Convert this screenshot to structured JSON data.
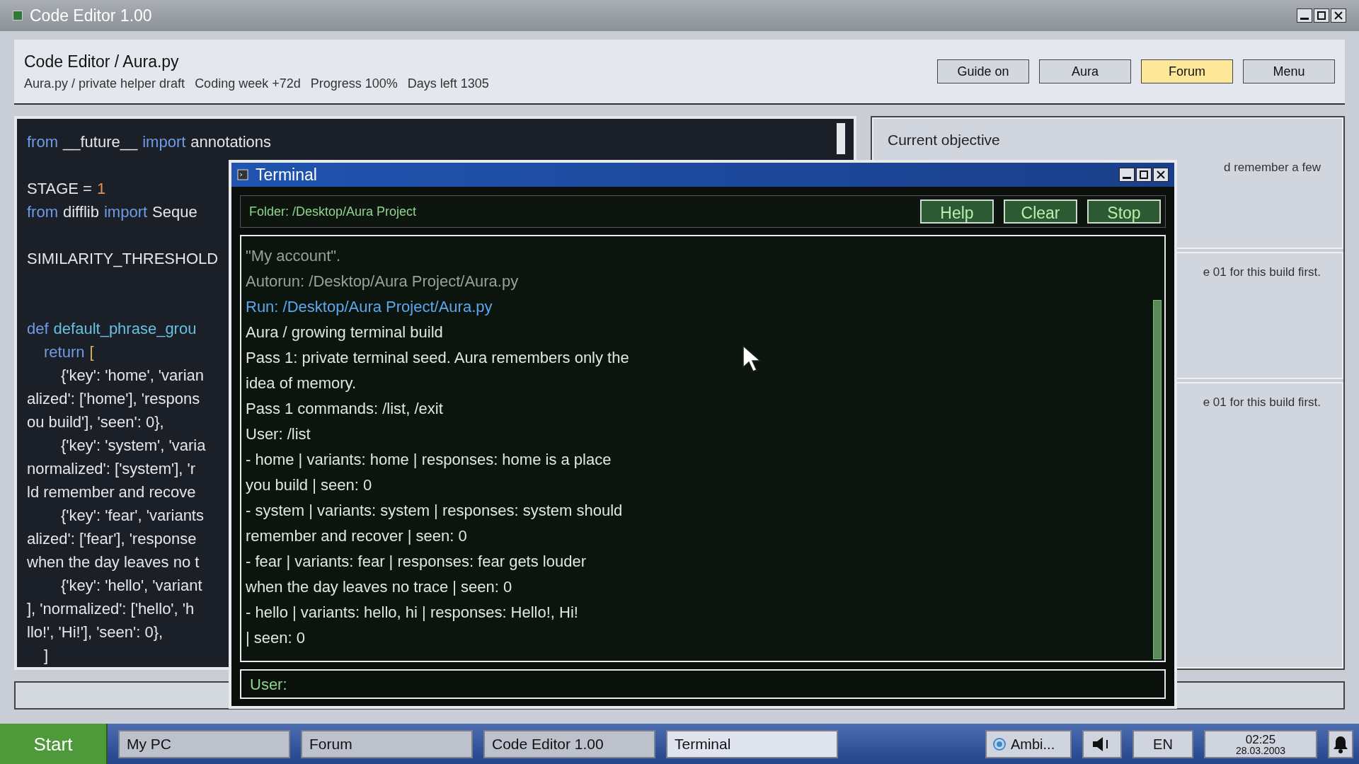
{
  "window": {
    "title": "Code Editor 1.00"
  },
  "header": {
    "title": "Code Editor / Aura.py",
    "subtitle": [
      "Aura.py / private helper draft",
      "Coding week +72d",
      "Progress 100%",
      "Days left 1305"
    ],
    "buttons": [
      {
        "label": "Guide on",
        "highlighted": false
      },
      {
        "label": "Aura",
        "highlighted": false
      },
      {
        "label": "Forum",
        "highlighted": true
      },
      {
        "label": "Menu",
        "highlighted": false
      }
    ]
  },
  "editor": {
    "lines": [
      {
        "kind": "code",
        "tokens": [
          {
            "kind": "keyword",
            "text": "from"
          },
          {
            "kind": "plain",
            "text": "__future__"
          },
          {
            "kind": "keyword",
            "text": "import"
          },
          {
            "kind": "plain",
            "text": "annotations"
          }
        ]
      },
      {
        "kind": "blank"
      },
      {
        "kind": "code",
        "tokens": [
          {
            "kind": "plain",
            "text": "STAGE ="
          },
          {
            "kind": "number",
            "text": "1"
          }
        ]
      },
      {
        "kind": "code",
        "tokens": [
          {
            "kind": "keyword",
            "text": "from"
          },
          {
            "kind": "plain",
            "text": "difflib"
          },
          {
            "kind": "keyword",
            "text": "import"
          },
          {
            "kind": "plain",
            "text": "Seque"
          }
        ]
      },
      {
        "kind": "blank"
      },
      {
        "kind": "code",
        "tokens": [
          {
            "kind": "plain",
            "text": "SIMILARITY_THRESHOLD"
          }
        ]
      },
      {
        "kind": "blank"
      },
      {
        "kind": "blank"
      },
      {
        "kind": "code",
        "tokens": [
          {
            "kind": "keyword",
            "text": "def"
          },
          {
            "kind": "function",
            "text": "default_phrase_grou"
          }
        ]
      },
      {
        "kind": "body",
        "tokens": [
          {
            "kind": "keyword",
            "text": "return"
          },
          {
            "kind": "bracket",
            "text": "["
          }
        ]
      },
      {
        "kind": "item",
        "tokens": [
          {
            "kind": "plain",
            "text": "{'key': 'home', 'varian"
          }
        ]
      },
      {
        "kind": "code",
        "tokens": [
          {
            "kind": "plain",
            "text": "alized': ['home'], 'respons"
          }
        ]
      },
      {
        "kind": "code",
        "tokens": [
          {
            "kind": "plain",
            "text": "ou build'], 'seen': 0},"
          }
        ]
      },
      {
        "kind": "item",
        "tokens": [
          {
            "kind": "plain",
            "text": "{'key': 'system', 'varia"
          }
        ]
      },
      {
        "kind": "code",
        "tokens": [
          {
            "kind": "plain",
            "text": "normalized': ['system'], 'r"
          }
        ]
      },
      {
        "kind": "code",
        "tokens": [
          {
            "kind": "plain",
            "text": "ld remember and recove"
          }
        ]
      },
      {
        "kind": "item",
        "tokens": [
          {
            "kind": "plain",
            "text": "{'key': 'fear', 'variants"
          }
        ]
      },
      {
        "kind": "code",
        "tokens": [
          {
            "kind": "plain",
            "text": "alized': ['fear'], 'response"
          }
        ]
      },
      {
        "kind": "code",
        "tokens": [
          {
            "kind": "plain",
            "text": "when the day leaves no t"
          }
        ]
      },
      {
        "kind": "item",
        "tokens": [
          {
            "kind": "plain",
            "text": "{'key': 'hello', 'variant"
          }
        ]
      },
      {
        "kind": "code",
        "tokens": [
          {
            "kind": "plain",
            "text": "], 'normalized': ['hello', 'h"
          }
        ]
      },
      {
        "kind": "code",
        "tokens": [
          {
            "kind": "plain",
            "text": "llo!', 'Hi!'], 'seen': 0},"
          }
        ]
      },
      {
        "kind": "body",
        "tokens": [
          {
            "kind": "plain",
            "text": "]"
          }
        ]
      }
    ]
  },
  "side_panels": [
    {
      "title": "Current objective",
      "text": "d remember a few"
    },
    {
      "text": "e 01 for this build first."
    },
    {
      "text": "e 01 for this build first."
    }
  ],
  "terminal": {
    "title": "Terminal",
    "folder": "Folder: /Desktop/Aura Project",
    "buttons": [
      "Help",
      "Clear",
      "Stop"
    ],
    "output": [
      {
        "kind": "muted",
        "text": "\"My account\"."
      },
      {
        "kind": "muted",
        "text": "Autorun: /Desktop/Aura Project/Aura.py"
      },
      {
        "kind": "link",
        "text": "Run: /Desktop/Aura Project/Aura.py"
      },
      {
        "kind": "plain",
        "text": "Aura / growing terminal build"
      },
      {
        "kind": "plain",
        "text": "Pass 1: private terminal seed. Aura remembers only the"
      },
      {
        "kind": "plain",
        "text": "idea of memory."
      },
      {
        "kind": "plain",
        "text": "Pass 1 commands: /list, /exit"
      },
      {
        "kind": "plain",
        "text": "User: /list"
      },
      {
        "kind": "plain",
        "text": "- home | variants: home | responses: home is a place"
      },
      {
        "kind": "plain",
        "text": "you build | seen: 0"
      },
      {
        "kind": "plain",
        "text": "- system | variants: system | responses: system should"
      },
      {
        "kind": "plain",
        "text": "remember and recover | seen: 0"
      },
      {
        "kind": "plain",
        "text": "- fear | variants: fear | responses: fear gets louder"
      },
      {
        "kind": "plain",
        "text": "when the day leaves no trace | seen: 0"
      },
      {
        "kind": "plain",
        "text": "- hello | variants: hello, hi | responses: Hello!, Hi!"
      },
      {
        "kind": "plain",
        "text": "| seen: 0"
      }
    ],
    "prompt": "User:"
  },
  "taskbar": {
    "start": "Start",
    "items": [
      {
        "label": "My PC",
        "selected": false
      },
      {
        "label": "Forum",
        "selected": false
      },
      {
        "label": "Code Editor 1.00",
        "selected": false
      },
      {
        "label": "Terminal",
        "selected": true
      }
    ],
    "tray": {
      "ambient": "Ambi...",
      "language": "EN",
      "time": "02:25",
      "date": "28.03.2003"
    }
  }
}
